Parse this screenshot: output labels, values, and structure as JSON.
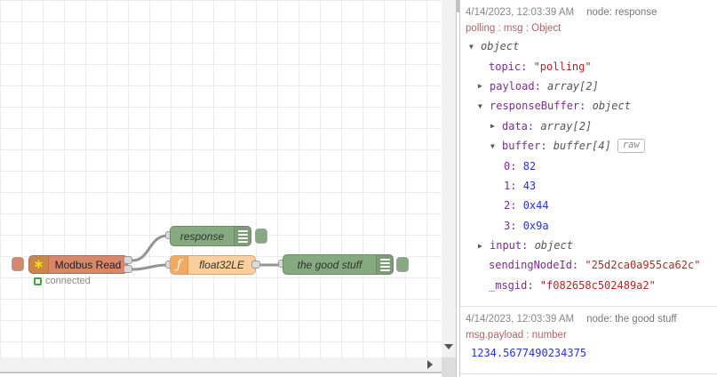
{
  "colors": {
    "modbus_node": "#d8876b",
    "debug_node": "#87a980",
    "function_node": "#fbcf9d",
    "wire": "#949494",
    "key": "#792e90",
    "string_value": "#b22828",
    "number_value": "#2435d4",
    "meta_value": "#555555",
    "msg_meta": "#aa6666",
    "status_ok": "#3fa33f"
  },
  "canvas": {
    "nodes": [
      {
        "label": "Modbus Read",
        "type": "modbus-read",
        "icon": "modbus-flower-icon"
      },
      {
        "label": "response",
        "type": "debug",
        "icon": "debug-bars-icon"
      },
      {
        "label": "float32LE",
        "type": "function",
        "icon": "function-f-icon"
      },
      {
        "label": "the good stuff",
        "type": "debug",
        "icon": "debug-bars-icon"
      }
    ],
    "status": {
      "label": "connected"
    },
    "modbus_icon_glyph": "✱",
    "function_icon_glyph": "ƒ"
  },
  "debug": {
    "messages": [
      {
        "timestamp": "4/14/2023, 12:03:39 AM",
        "source": "node: response",
        "meta": "polling : msg : Object",
        "rows": [
          {
            "indent": 4,
            "arrow": "down",
            "meta": "object"
          },
          {
            "indent": 26,
            "arrow": "none",
            "key": "topic",
            "value": "\"polling\"",
            "vtype": "string"
          },
          {
            "indent": 14,
            "arrow": "right",
            "key": "payload",
            "value": "array[2]",
            "vtype": "meta"
          },
          {
            "indent": 14,
            "arrow": "down",
            "key": "responseBuffer",
            "value": "object",
            "vtype": "meta"
          },
          {
            "indent": 28,
            "arrow": "right",
            "key": "data",
            "value": "array[2]",
            "vtype": "meta"
          },
          {
            "indent": 28,
            "arrow": "down",
            "key": "buffer",
            "value": "buffer[4]",
            "vtype": "meta",
            "raw": "raw"
          },
          {
            "indent": 43,
            "arrow": "none",
            "key": "0",
            "value": "82",
            "vtype": "number"
          },
          {
            "indent": 43,
            "arrow": "none",
            "key": "1",
            "value": "43",
            "vtype": "number"
          },
          {
            "indent": 43,
            "arrow": "none",
            "key": "2",
            "value": "0x44",
            "vtype": "number"
          },
          {
            "indent": 43,
            "arrow": "none",
            "key": "3",
            "value": "0x9a",
            "vtype": "number"
          },
          {
            "indent": 14,
            "arrow": "right",
            "key": "input",
            "value": "object",
            "vtype": "meta"
          },
          {
            "indent": 26,
            "arrow": "none",
            "key": "sendingNodeId",
            "value": "\"25d2ca0a955ca62c\"",
            "vtype": "string"
          },
          {
            "indent": 26,
            "arrow": "none",
            "key": "_msgid",
            "value": "\"f082658c502489a2\"",
            "vtype": "string"
          }
        ]
      },
      {
        "timestamp": "4/14/2023, 12:03:39 AM",
        "source": "node: the good stuff",
        "meta": "msg.payload : number",
        "rows": [
          {
            "indent": 6,
            "arrow": "none",
            "value": "1234.5677490234375",
            "vtype": "number"
          }
        ]
      }
    ]
  }
}
